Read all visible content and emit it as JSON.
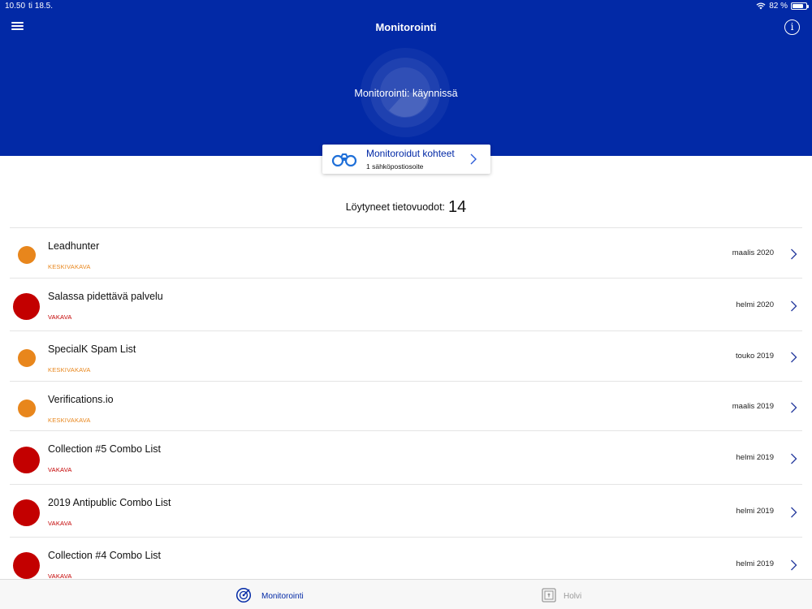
{
  "status_bar": {
    "time": "10.50",
    "date": "ti 18.5.",
    "battery_percent_label": "82 %",
    "battery_level": 0.82
  },
  "header": {
    "title": "Monitorointi",
    "monitor_status": "Monitorointi: käynnissä"
  },
  "monitored_targets": {
    "title": "Monitoroidut kohteet",
    "subtitle": "1 sähköpostiosoite"
  },
  "breaches": {
    "label": "Löytyneet tietovuodot:",
    "count": "14",
    "items": [
      {
        "name": "Leadhunter",
        "severity": "KESKIVAKAVA",
        "level": "med",
        "date": "maalis 2020"
      },
      {
        "name": "Salassa pidettävä palvelu",
        "severity": "VAKAVA",
        "level": "high",
        "date": "helmi 2020"
      },
      {
        "name": "SpecialK Spam List",
        "severity": "KESKIVAKAVA",
        "level": "med",
        "date": "touko 2019"
      },
      {
        "name": "Verifications.io",
        "severity": "KESKIVAKAVA",
        "level": "med",
        "date": "maalis 2019"
      },
      {
        "name": "Collection #5 Combo List",
        "severity": "VAKAVA",
        "level": "high",
        "date": "helmi 2019"
      },
      {
        "name": "2019 Antipublic Combo List",
        "severity": "VAKAVA",
        "level": "high",
        "date": "helmi 2019"
      },
      {
        "name": "Collection #4 Combo List",
        "severity": "VAKAVA",
        "level": "high",
        "date": "helmi 2019"
      }
    ]
  },
  "colors": {
    "brand": "#0229a6",
    "medium": "#e8861c",
    "high": "#c30000"
  },
  "icons": {
    "menu": "hamburger-icon",
    "info": "info-icon",
    "targets": "binoculars-icon",
    "row_chevron": "chevron-right-icon",
    "tab_monitor": "radar-icon",
    "tab_vault": "vault-icon"
  },
  "tabs": [
    {
      "label": "Monitorointi",
      "active": true
    },
    {
      "label": "Holvi",
      "active": false
    }
  ]
}
